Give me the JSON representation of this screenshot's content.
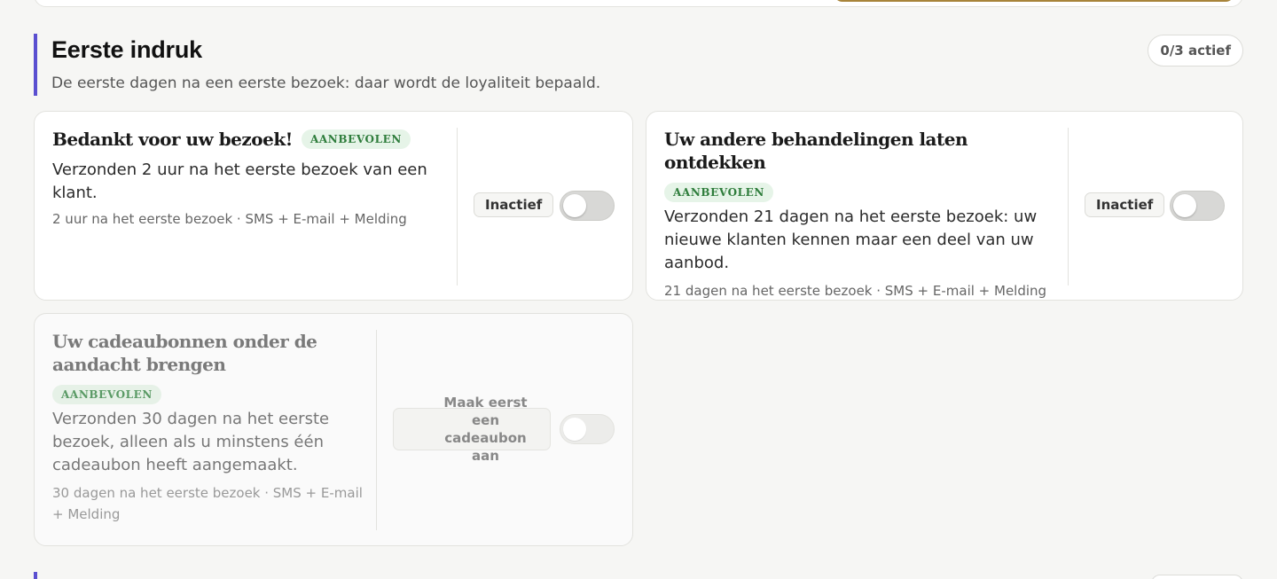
{
  "section": {
    "title": "Eerste indruk",
    "subtitle": "De eerste dagen na een eerste bezoek: daar wordt de loyaliteit bepaald.",
    "count": "0/3 actief"
  },
  "cards": [
    {
      "title": "Bedankt voor uw bezoek!",
      "badge": "AANBEVOLEN",
      "description": "Verzonden 2 uur na het eerste bezoek van een klant.",
      "meta": "2 uur na het eerste bezoek · SMS + E-mail + Melding",
      "status": "Inactief",
      "enabled": false
    },
    {
      "title": "Uw andere behandelingen laten ontdekken",
      "badge": "AANBEVOLEN",
      "description": "Verzonden 21 dagen na het eerste bezoek: uw nieuwe klanten kennen maar een deel van uw aanbod.",
      "meta": "21 dagen na het eerste bezoek · SMS + E-mail + Melding",
      "status": "Inactief",
      "enabled": false
    },
    {
      "title": "Uw cadeaubonnen onder de aandacht brengen",
      "badge": "AANBEVOLEN",
      "description": "Verzonden 30 dagen na het eerste bezoek, alleen als u minstens één cadeaubon heeft aangemaakt.",
      "meta": "30 dagen na het eerste bezoek · SMS + E-mail + Melding",
      "status": "Maak eerst een cadeaubon aan",
      "enabled": false
    }
  ],
  "colors": {
    "accent": "#5a4fd0",
    "badge_bg": "#e6f4e8",
    "badge_text": "#2f7d3c",
    "gold": "#a8843a"
  }
}
